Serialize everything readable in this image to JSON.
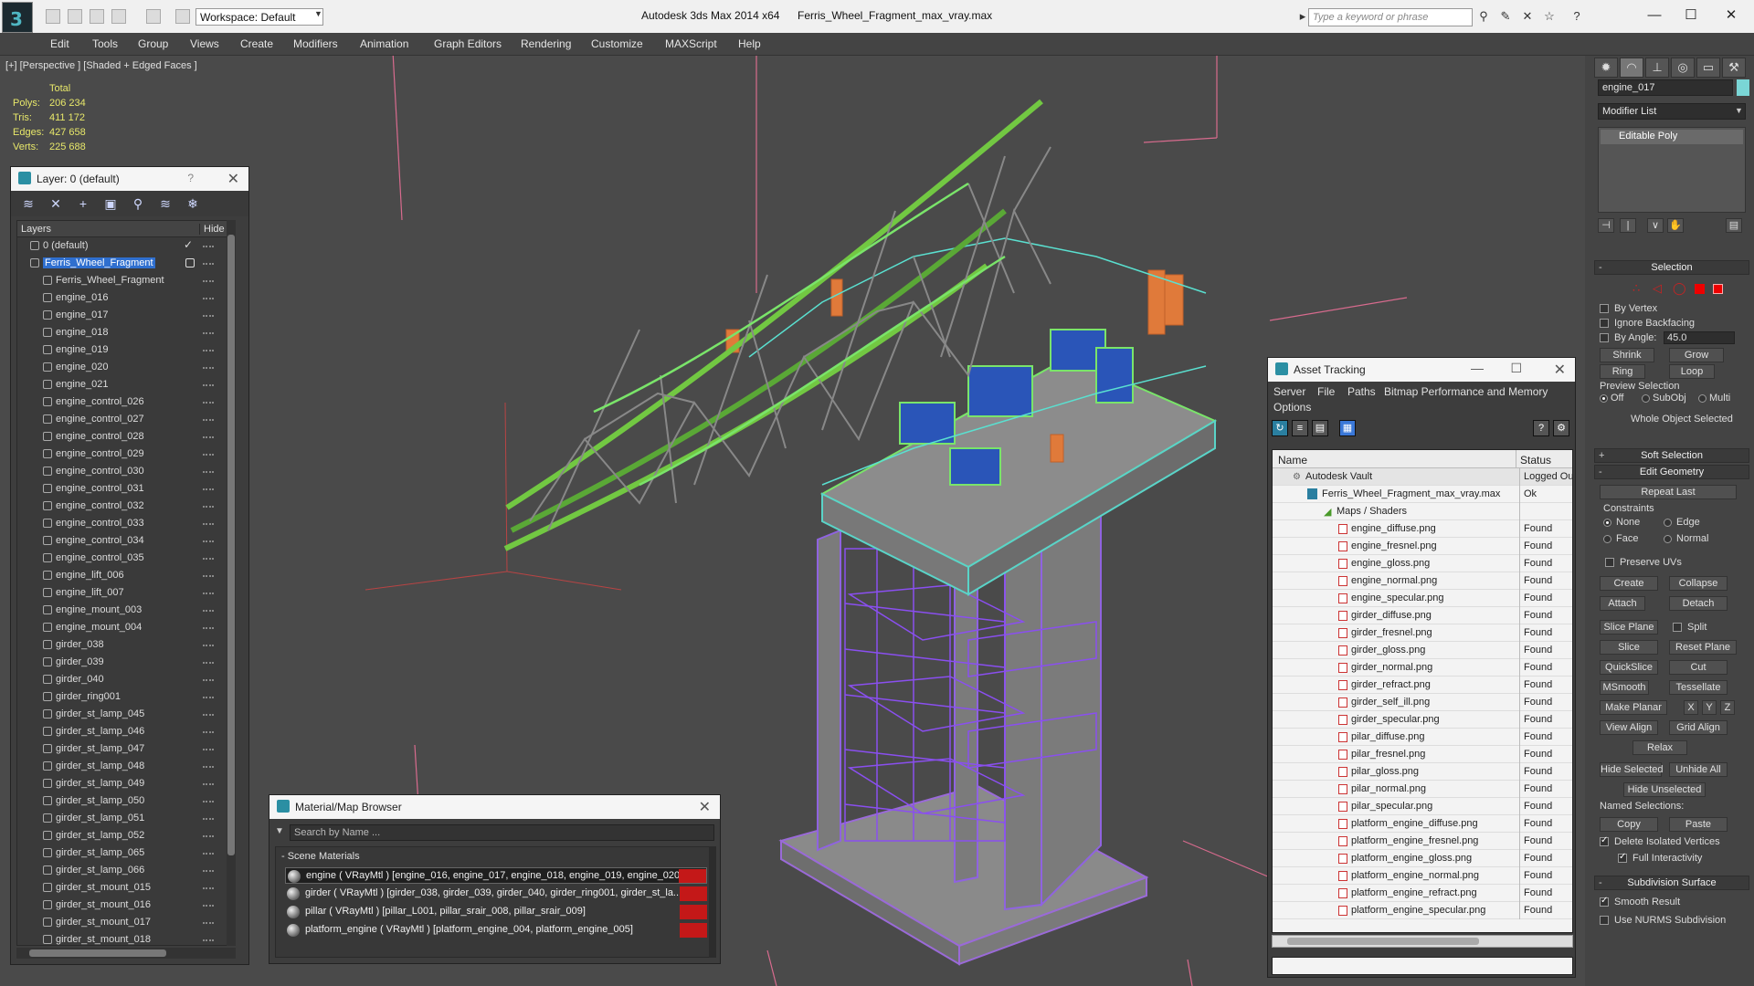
{
  "titlebar": {
    "app_title": "Autodesk 3ds Max  2014 x64",
    "file_title": "Ferris_Wheel_Fragment_max_vray.max",
    "workspace": "Workspace: Default",
    "search_placeholder": "Type a keyword or phrase",
    "logo_glyph": "3"
  },
  "menu": [
    "Edit",
    "Tools",
    "Group",
    "Views",
    "Create",
    "Modifiers",
    "Animation",
    "Graph Editors",
    "Rendering",
    "Customize",
    "MAXScript",
    "Help"
  ],
  "viewport": {
    "label": "[+] [Perspective ] [Shaded + Edged Faces ]",
    "stats": {
      "total_label": "Total",
      "polys_label": "Polys:",
      "polys": "206 234",
      "tris_label": "Tris:",
      "tris": "411 172",
      "edges_label": "Edges:",
      "edges": "427 658",
      "verts_label": "Verts:",
      "verts": "225 688"
    }
  },
  "layer_panel": {
    "title": "Layer: 0 (default)",
    "help": "?",
    "col_layers": "Layers",
    "col_hide": "Hide",
    "rows": [
      {
        "name": "0 (default)",
        "indent": 1
      },
      {
        "name": "Ferris_Wheel_Fragment",
        "indent": 1,
        "selected": true
      },
      {
        "name": "Ferris_Wheel_Fragment",
        "indent": 2
      },
      {
        "name": "engine_016",
        "indent": 2
      },
      {
        "name": "engine_017",
        "indent": 2
      },
      {
        "name": "engine_018",
        "indent": 2
      },
      {
        "name": "engine_019",
        "indent": 2
      },
      {
        "name": "engine_020",
        "indent": 2
      },
      {
        "name": "engine_021",
        "indent": 2
      },
      {
        "name": "engine_control_026",
        "indent": 2
      },
      {
        "name": "engine_control_027",
        "indent": 2
      },
      {
        "name": "engine_control_028",
        "indent": 2
      },
      {
        "name": "engine_control_029",
        "indent": 2
      },
      {
        "name": "engine_control_030",
        "indent": 2
      },
      {
        "name": "engine_control_031",
        "indent": 2
      },
      {
        "name": "engine_control_032",
        "indent": 2
      },
      {
        "name": "engine_control_033",
        "indent": 2
      },
      {
        "name": "engine_control_034",
        "indent": 2
      },
      {
        "name": "engine_control_035",
        "indent": 2
      },
      {
        "name": "engine_lift_006",
        "indent": 2
      },
      {
        "name": "engine_lift_007",
        "indent": 2
      },
      {
        "name": "engine_mount_003",
        "indent": 2
      },
      {
        "name": "engine_mount_004",
        "indent": 2
      },
      {
        "name": "girder_038",
        "indent": 2
      },
      {
        "name": "girder_039",
        "indent": 2
      },
      {
        "name": "girder_040",
        "indent": 2
      },
      {
        "name": "girder_ring001",
        "indent": 2
      },
      {
        "name": "girder_st_lamp_045",
        "indent": 2
      },
      {
        "name": "girder_st_lamp_046",
        "indent": 2
      },
      {
        "name": "girder_st_lamp_047",
        "indent": 2
      },
      {
        "name": "girder_st_lamp_048",
        "indent": 2
      },
      {
        "name": "girder_st_lamp_049",
        "indent": 2
      },
      {
        "name": "girder_st_lamp_050",
        "indent": 2
      },
      {
        "name": "girder_st_lamp_051",
        "indent": 2
      },
      {
        "name": "girder_st_lamp_052",
        "indent": 2
      },
      {
        "name": "girder_st_lamp_065",
        "indent": 2
      },
      {
        "name": "girder_st_lamp_066",
        "indent": 2
      },
      {
        "name": "girder_st_mount_015",
        "indent": 2
      },
      {
        "name": "girder_st_mount_016",
        "indent": 2
      },
      {
        "name": "girder_st_mount_017",
        "indent": 2
      },
      {
        "name": "girder_st_mount_018",
        "indent": 2
      }
    ]
  },
  "material_browser": {
    "title": "Material/Map Browser",
    "search_placeholder": "Search by Name ...",
    "group": "- Scene Materials",
    "materials": [
      "engine  ( VRayMtl )  [engine_016, engine_017, engine_018, engine_019, engine_020...",
      "girder  ( VRayMtl ) [girder_038, girder_039, girder_040, girder_ring001, girder_st_la...",
      "pillar  ( VRayMtl ) [pillar_L001, pillar_srair_008, pillar_srair_009]",
      "platform_engine  ( VRayMtl ) [platform_engine_004, platform_engine_005]"
    ]
  },
  "asset_tracking": {
    "title": "Asset Tracking",
    "menu": [
      "Server",
      "File",
      "Paths",
      "Bitmap Performance and Memory",
      "Options"
    ],
    "col_name": "Name",
    "col_status": "Status",
    "vault": {
      "name": "Autodesk Vault",
      "status": "Logged Ou"
    },
    "file": {
      "name": "Ferris_Wheel_Fragment_max_vray.max",
      "status": "Ok"
    },
    "maps_group": "Maps / Shaders",
    "maps": [
      {
        "name": "engine_diffuse.png",
        "status": "Found"
      },
      {
        "name": "engine_fresnel.png",
        "status": "Found"
      },
      {
        "name": "engine_gloss.png",
        "status": "Found"
      },
      {
        "name": "engine_normal.png",
        "status": "Found"
      },
      {
        "name": "engine_specular.png",
        "status": "Found"
      },
      {
        "name": "girder_diffuse.png",
        "status": "Found"
      },
      {
        "name": "girder_fresnel.png",
        "status": "Found"
      },
      {
        "name": "girder_gloss.png",
        "status": "Found"
      },
      {
        "name": "girder_normal.png",
        "status": "Found"
      },
      {
        "name": "girder_refract.png",
        "status": "Found"
      },
      {
        "name": "girder_self_ill.png",
        "status": "Found"
      },
      {
        "name": "girder_specular.png",
        "status": "Found"
      },
      {
        "name": "pilar_diffuse.png",
        "status": "Found"
      },
      {
        "name": "pilar_fresnel.png",
        "status": "Found"
      },
      {
        "name": "pilar_gloss.png",
        "status": "Found"
      },
      {
        "name": "pilar_normal.png",
        "status": "Found"
      },
      {
        "name": "pilar_specular.png",
        "status": "Found"
      },
      {
        "name": "platform_engine_diffuse.png",
        "status": "Found"
      },
      {
        "name": "platform_engine_fresnel.png",
        "status": "Found"
      },
      {
        "name": "platform_engine_gloss.png",
        "status": "Found"
      },
      {
        "name": "platform_engine_normal.png",
        "status": "Found"
      },
      {
        "name": "platform_engine_refract.png",
        "status": "Found"
      },
      {
        "name": "platform_engine_specular.png",
        "status": "Found"
      }
    ]
  },
  "command_panel": {
    "object_name": "engine_017",
    "object_color": "#7ad6d6",
    "modifier_list": "Modifier List",
    "stack_item": "Editable Poly",
    "selection": {
      "header": "Selection",
      "by_vertex": "By Vertex",
      "ignore_backfacing": "Ignore Backfacing",
      "by_angle": "By Angle:",
      "angle_value": "45.0",
      "shrink": "Shrink",
      "grow": "Grow",
      "ring": "Ring",
      "loop": "Loop",
      "preview_label": "Preview Selection",
      "off": "Off",
      "subobj": "SubObj",
      "multi": "Multi",
      "status": "Whole Object Selected"
    },
    "soft_selection": "Soft Selection",
    "edit_geometry": {
      "header": "Edit Geometry",
      "repeat_last": "Repeat Last",
      "constraints": "Constraints",
      "none": "None",
      "edge": "Edge",
      "face": "Face",
      "normal": "Normal",
      "preserve_uvs": "Preserve UVs",
      "create": "Create",
      "collapse": "Collapse",
      "attach": "Attach",
      "detach": "Detach",
      "slice_plane": "Slice Plane",
      "split": "Split",
      "slice": "Slice",
      "reset_plane": "Reset Plane",
      "quickslice": "QuickSlice",
      "cut": "Cut",
      "msmooth": "MSmooth",
      "tessellate": "Tessellate",
      "make_planar": "Make Planar",
      "x": "X",
      "y": "Y",
      "z": "Z",
      "view_align": "View Align",
      "grid_align": "Grid Align",
      "relax": "Relax",
      "hide_selected": "Hide Selected",
      "unhide_all": "Unhide All",
      "hide_unselected": "Hide Unselected",
      "named_selections": "Named Selections:",
      "copy": "Copy",
      "paste": "Paste",
      "delete_isolated": "Delete Isolated Vertices",
      "full_interactivity": "Full Interactivity"
    },
    "subdivision": {
      "header": "Subdivision Surface",
      "smooth_result": "Smooth Result",
      "use_nurms": "Use NURMS Subdivision"
    }
  }
}
